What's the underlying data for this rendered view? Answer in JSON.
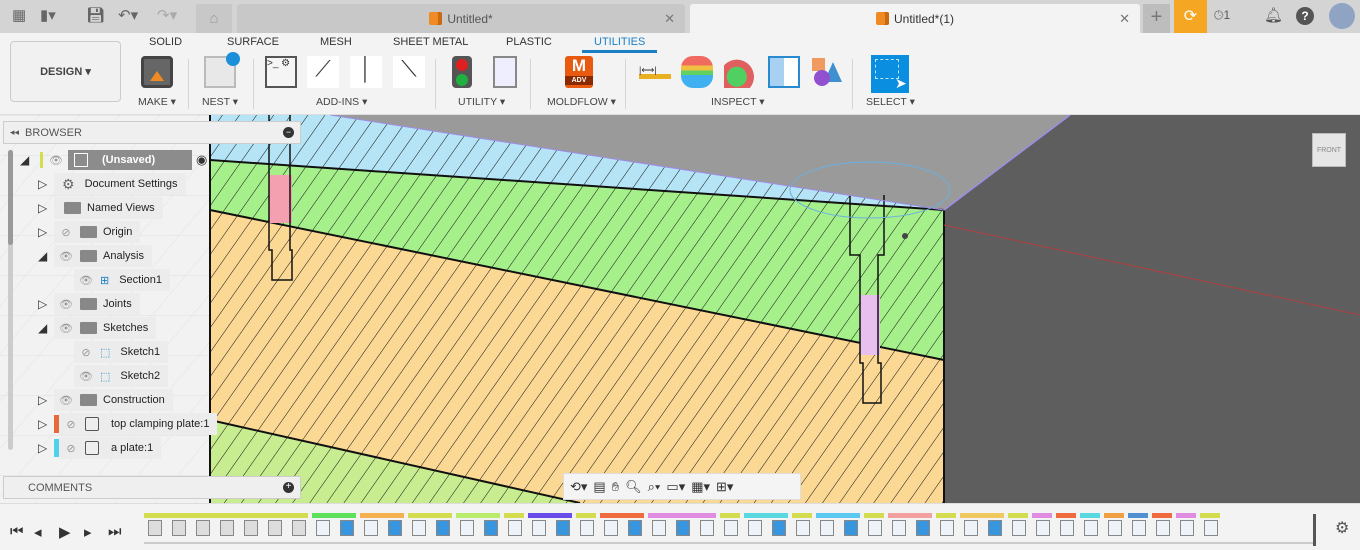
{
  "tabs": [
    {
      "label": "Untitled*",
      "active": false
    },
    {
      "label": "Untitled*(1)",
      "active": true
    }
  ],
  "header": {
    "jobs_count": "1"
  },
  "workspace": "DESIGN",
  "ribbon_tabs": [
    "SOLID",
    "SURFACE",
    "MESH",
    "SHEET METAL",
    "PLASTIC",
    "UTILITIES"
  ],
  "active_ribbon_tab": "UTILITIES",
  "groups": {
    "make": "MAKE",
    "nest": "NEST",
    "addins": "ADD-INS",
    "utility": "UTILITY",
    "moldflow": "MOLDFLOW",
    "moldflow_badge": "ADV",
    "moldflow_letter": "M",
    "inspect": "INSPECT",
    "select": "SELECT"
  },
  "browser": {
    "title": "BROWSER",
    "root": "(Unsaved)",
    "items": [
      {
        "label": "Document Settings"
      },
      {
        "label": "Named Views"
      },
      {
        "label": "Origin"
      },
      {
        "label": "Analysis"
      },
      {
        "label": "Section1"
      },
      {
        "label": "Joints"
      },
      {
        "label": "Sketches"
      },
      {
        "label": "Sketch1"
      },
      {
        "label": "Sketch2"
      },
      {
        "label": "Construction"
      },
      {
        "label": "top clamping plate:1",
        "color": "#e8683a"
      },
      {
        "label": "a plate:1",
        "color": "#4fd0ec"
      }
    ]
  },
  "comments": {
    "title": "COMMENTS"
  },
  "viewcube": {
    "face": "FRONT"
  },
  "timeline": {
    "groups": [
      [
        "#d4dc50",
        7
      ],
      [
        "#5ee05a",
        2
      ],
      [
        "#f5b050",
        2
      ],
      [
        "#d4dc50",
        2
      ],
      [
        "#b8ec6a",
        2
      ],
      [
        "#d4dc50",
        1
      ],
      [
        "#6a4ce8",
        2
      ],
      [
        "#d4dc50",
        1
      ],
      [
        "#f06a40",
        2
      ],
      [
        "#e08ce0",
        3
      ],
      [
        "#d4dc50",
        1
      ],
      [
        "#5ad8e0",
        2
      ],
      [
        "#d4dc50",
        1
      ],
      [
        "#5ac8f0",
        2
      ],
      [
        "#d4dc50",
        1
      ],
      [
        "#f4a0a0",
        2
      ],
      [
        "#d4dc50",
        1
      ],
      [
        "#f0c860",
        2
      ],
      [
        "#d4dc50",
        1
      ],
      [
        "#e08ce0",
        1
      ],
      [
        "#f06a40",
        1
      ],
      [
        "#5ad8e0",
        1
      ],
      [
        "#f0a040",
        1
      ],
      [
        "#5090d0",
        1
      ],
      [
        "#f06a40",
        1
      ],
      [
        "#e08ce0",
        1
      ],
      [
        "#d4dc50",
        1
      ]
    ]
  }
}
